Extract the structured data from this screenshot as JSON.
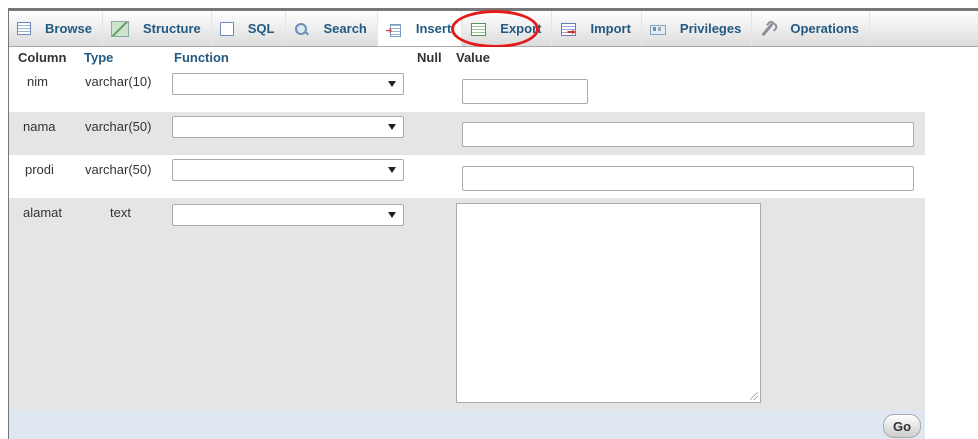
{
  "tabs": [
    {
      "label": "Browse",
      "icon": "browse-icon"
    },
    {
      "label": "Structure",
      "icon": "structure-icon"
    },
    {
      "label": "SQL",
      "icon": "sql-icon"
    },
    {
      "label": "Search",
      "icon": "search-icon"
    },
    {
      "label": "Insert",
      "icon": "insert-icon",
      "active": true
    },
    {
      "label": "Export",
      "icon": "export-icon"
    },
    {
      "label": "Import",
      "icon": "import-icon"
    },
    {
      "label": "Privileges",
      "icon": "privileges-icon"
    },
    {
      "label": "Operations",
      "icon": "operations-icon"
    }
  ],
  "header": {
    "column": "Column",
    "type": "Type",
    "function": "Function",
    "null": "Null",
    "value": "Value"
  },
  "rows": [
    {
      "column": "nim",
      "type": "varchar(10)",
      "function": "",
      "value": ""
    },
    {
      "column": "nama",
      "type": "varchar(50)",
      "function": "",
      "value": ""
    },
    {
      "column": "prodi",
      "type": "varchar(50)",
      "function": "",
      "value": ""
    },
    {
      "column": "alamat",
      "type": "text",
      "function": "",
      "value": ""
    }
  ],
  "footer": {
    "go_label": "Go"
  },
  "colors": {
    "link": "#235a81",
    "row_grey": "#e5e5e5",
    "footer": "#dee7f2",
    "highlight": "#e31b1b"
  }
}
